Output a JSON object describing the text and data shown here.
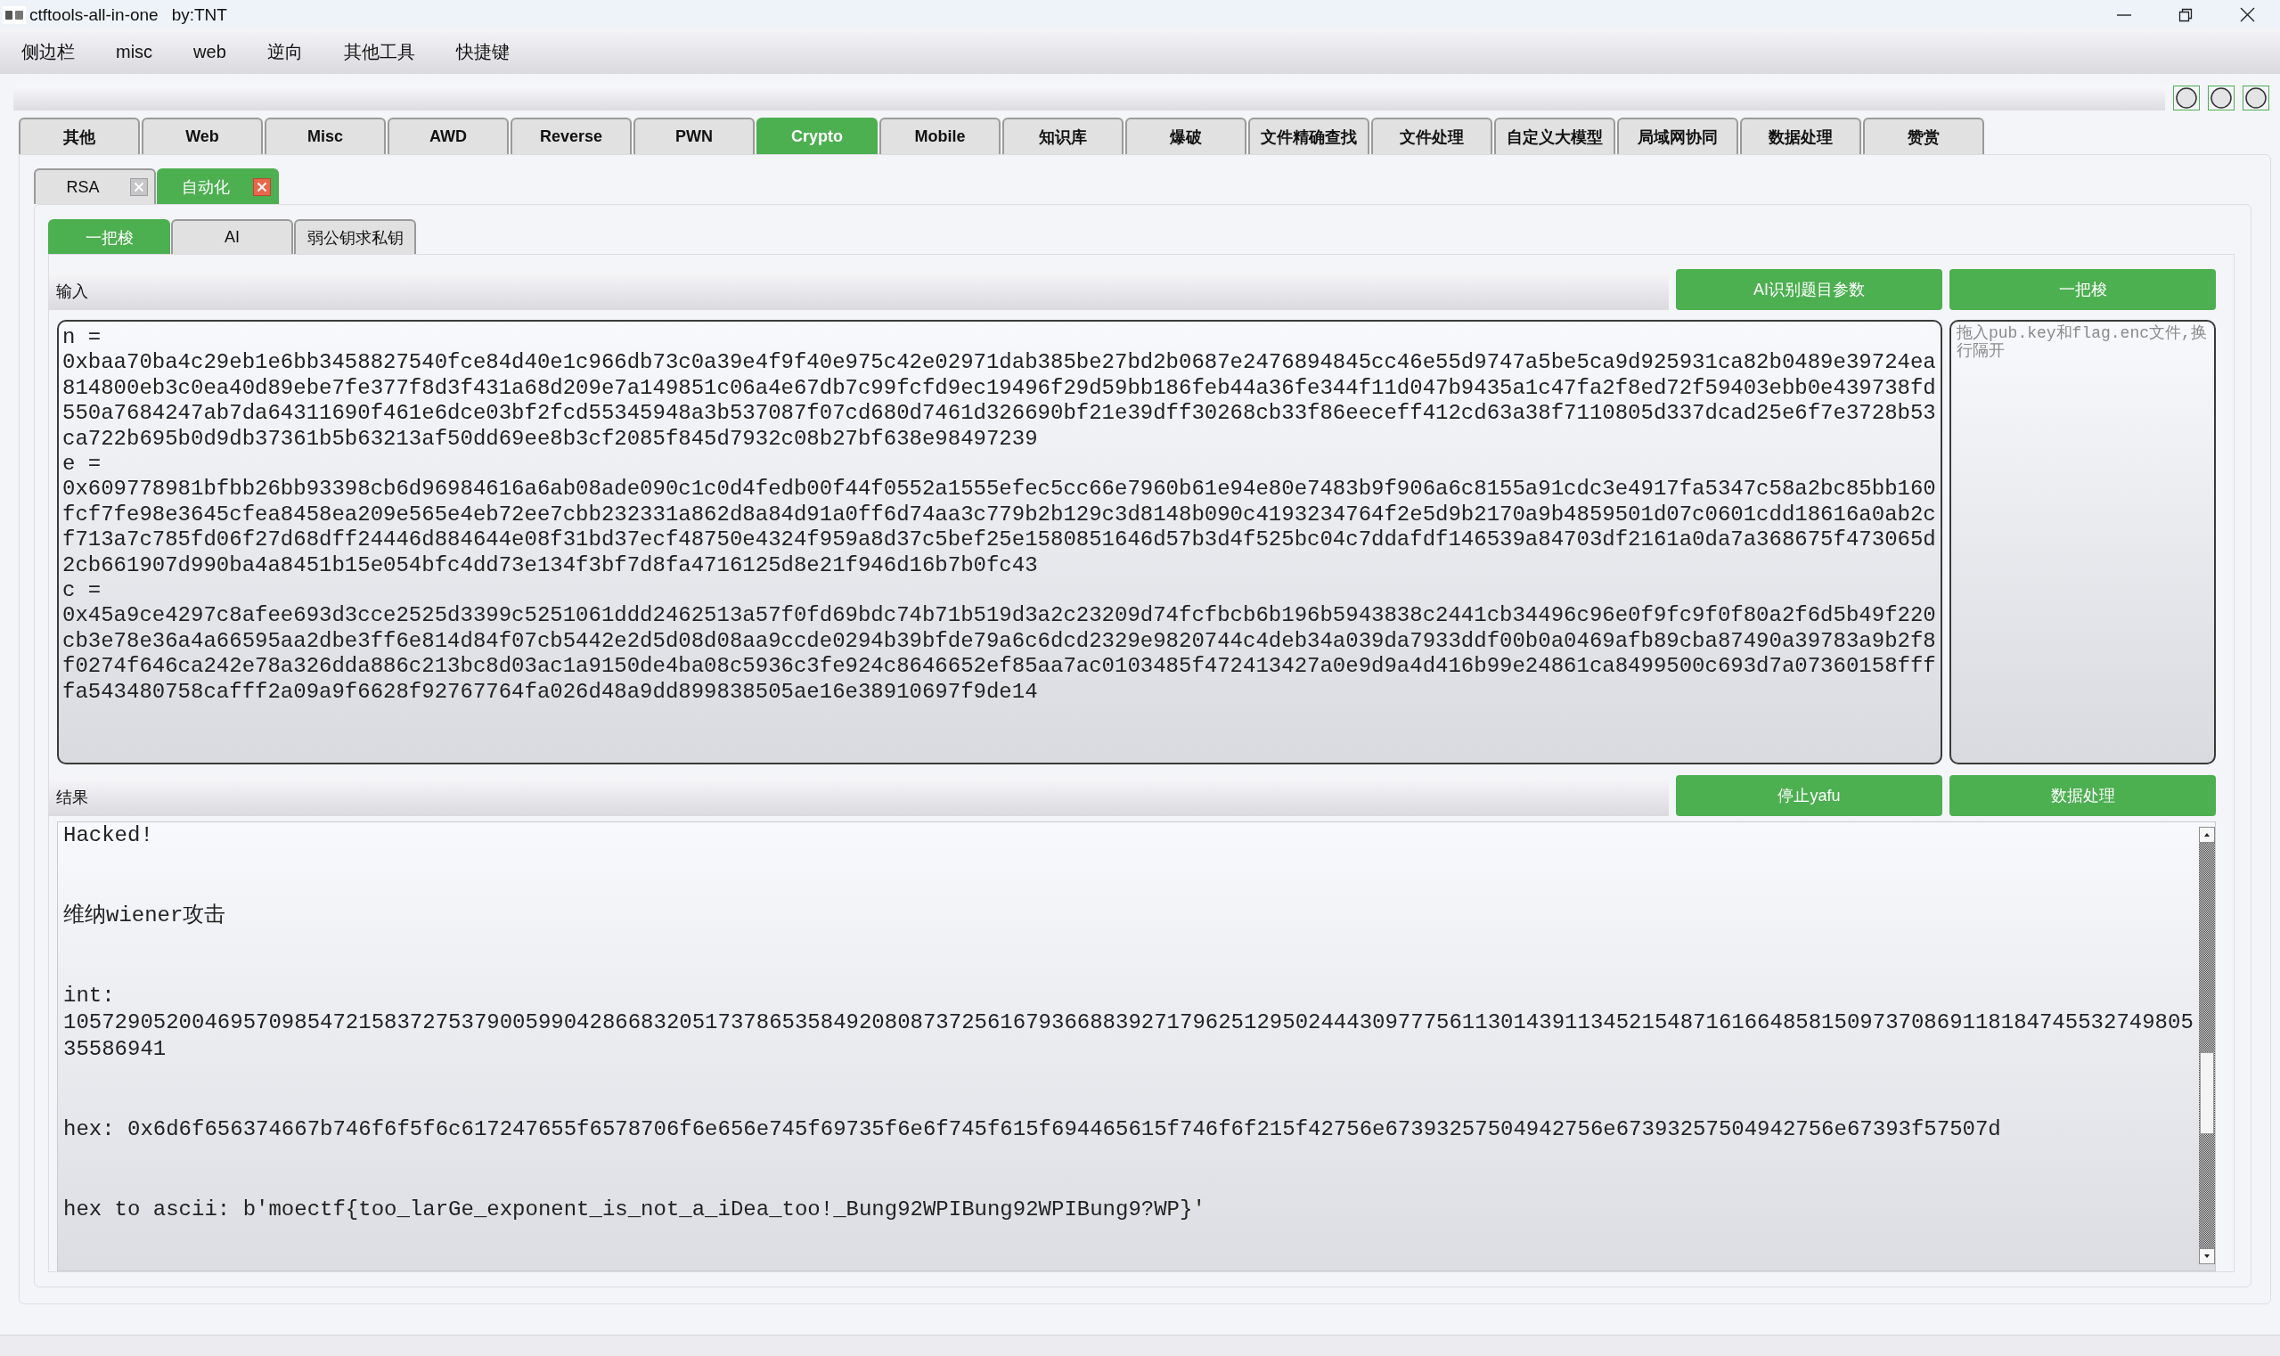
{
  "window": {
    "title": "ctftools-all-in-one",
    "author": "by:TNT"
  },
  "menu": [
    "侧边栏",
    "misc",
    "web",
    "逆向",
    "其他工具",
    "快捷键"
  ],
  "tabs": [
    {
      "label": "其他",
      "selected": false
    },
    {
      "label": "Web",
      "selected": false
    },
    {
      "label": "Misc",
      "selected": false
    },
    {
      "label": "AWD",
      "selected": false
    },
    {
      "label": "Reverse",
      "selected": false
    },
    {
      "label": "PWN",
      "selected": false
    },
    {
      "label": "Crypto",
      "selected": true
    },
    {
      "label": "Mobile",
      "selected": false
    },
    {
      "label": "知识库",
      "selected": false
    },
    {
      "label": "爆破",
      "selected": false
    },
    {
      "label": "文件精确查找",
      "selected": false
    },
    {
      "label": "文件处理",
      "selected": false
    },
    {
      "label": "自定义大模型",
      "selected": false
    },
    {
      "label": "局域网协同",
      "selected": false
    },
    {
      "label": "数据处理",
      "selected": false
    },
    {
      "label": "赞赏",
      "selected": false
    }
  ],
  "sub_tabs": [
    {
      "label": "RSA",
      "selected": false
    },
    {
      "label": "自动化",
      "selected": true
    }
  ],
  "tool_tabs": [
    {
      "label": "一把梭",
      "selected": true
    },
    {
      "label": "AI",
      "selected": false
    },
    {
      "label": "弱公钥求私钥",
      "selected": false
    }
  ],
  "input": {
    "label": "输入",
    "buttons": [
      "AI识别题目参数",
      "一把梭"
    ],
    "lines": [
      "n =",
      "0xbaa70ba4c29eb1e6bb3458827540fce84d40e1c966db73c0a39e4f9f40e975c42e02971dab385be27bd2b0687e2476894845cc46e55d9747a5be5ca9d925931ca82b0489e39724ea814800eb3c0ea40d89ebe7fe377f8d3f431a68d209e7a149851c06a4e67db7c99fcfd9ec19496f29d59bb186feb44a36fe344f11d047b9435a1c47fa2f8ed72f59403ebb0e439738fd550a7684247ab7da64311690f461e6dce03bf2fcd55345948a3b537087f07cd680d7461d326690bf21e39dff30268cb33f86eeceff412cd63a38f7110805d337dcad25e6f7e3728b53ca722b695b0d9db37361b5b63213af50dd69ee8b3cf2085f845d7932c08b27bf638e98497239",
      "e =",
      "0x609778981bfbb26bb93398cb6d96984616a6ab08ade090c1c0d4fedb00f44f0552a1555efec5cc66e7960b61e94e80e7483b9f906a6c8155a91cdc3e4917fa5347c58a2bc85bb160fcf7fe98e3645cfea8458ea209e565e4eb72ee7cbb232331a862d8a84d91a0ff6d74aa3c779b2b129c3d8148b090c4193234764f2e5d9b2170a9b4859501d07c0601cdd18616a0ab2cf713a7c785fd06f27d68dff24446d884644e08f31bd37ecf48750e4324f959a8d37c5bef25e1580851646d57b3d4f525bc04c7ddafdf146539a84703df2161a0da7a368675f473065d2cb661907d990ba4a8451b15e054bfc4dd73e134f3bf7d8fa4716125d8e21f946d16b7b0fc43",
      "c =",
      "0x45a9ce4297c8afee693d3cce2525d3399c5251061ddd2462513a57f0fd69bdc74b71b519d3a2c23209d74fcfbcb6b196b5943838c2441cb34496c96e0f9fc9f0f80a2f6d5b49f220cb3e78e36a4a66595aa2dbe3ff6e814d84f07cb5442e2d5d08d08aa9ccde0294b39bfde79a6c6dcd2329e9820744c4deb34a039da7933ddf00b0a0469afb89cba87490a39783a9b2f8f0274f646ca242e78a326dda886c213bc8d03ac1a9150de4ba08c5936c3fe924c8646652ef85aa7ac0103485f472413427a0e9d9a4d416b99e24861ca8499500c693d7a07360158ffffa543480758cafff2a09a9f6628f92767764fa026d48a9dd899838505ae16e38910697f9de14"
    ],
    "file_drop": {
      "placeholder": "拖入pub.key和flag.enc文件,换行隔开"
    }
  },
  "result": {
    "label": "结果",
    "buttons": [
      "停止yafu",
      "数据处理"
    ],
    "paragraphs": [
      {
        "lines": [
          "Hacked!"
        ]
      },
      {
        "lines": [
          "维纳wiener攻击"
        ]
      },
      {
        "lines": [
          "int:",
          "1057290520046957098547215837275379005990428668320517378653584920808737256167936688392717962512950244430977756113014391134521548716166485815097370869118184745532749805 35586941"
        ]
      },
      {
        "lines": [
          "hex: 0x6d6f656374667b746f6f5f6c617247655f6578706f6e656e745f69735f6e6f745f615f694465615f746f6f215f42756e67393257504942756e67393257504942756e67393f57507d"
        ]
      },
      {
        "lines": [
          "hex to ascii: b'moectf{too_larGe_exponent_is_not_a_iDea_too!_Bung92WPIBung92WPIBung9?WP}'"
        ]
      }
    ]
  }
}
